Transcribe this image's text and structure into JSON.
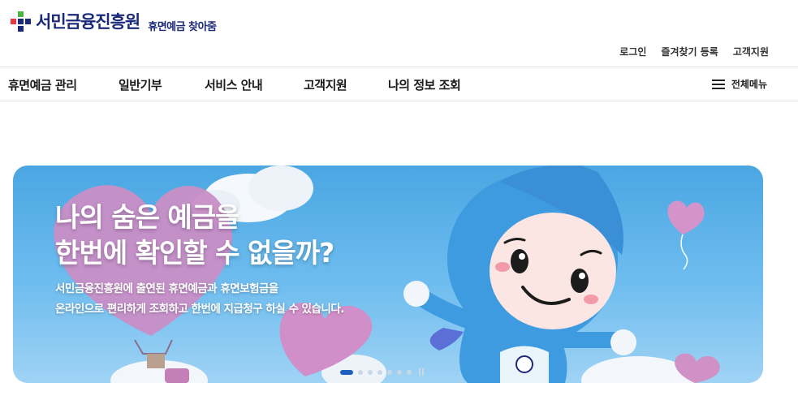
{
  "header": {
    "logo_text": "서민금융진흥원",
    "logo_sub": "휴면예금 찾아줌",
    "util_links": [
      "로그인",
      "즐겨찾기 등록",
      "고객지원"
    ]
  },
  "gnb": {
    "items": [
      "휴면예금 관리",
      "일반기부",
      "서비스 안내",
      "고객지원",
      "나의 정보 조회"
    ],
    "all_menu_label": "전체메뉴"
  },
  "banner": {
    "headline_line1": "나의 숨은 예금을",
    "headline_line2": "한번에 확인할 수 없을까?",
    "desc_line1": "서민금융진흥원에 출연된 휴면예금과 휴면보험금을",
    "desc_line2": "온라인으로 편리하게 조회하고 한번에 지급청구 하실 수 있습니다.",
    "slide_count": 7,
    "active_slide": 1
  },
  "colors": {
    "brand_navy": "#1b2a78",
    "banner_blue": "#4aa6e2",
    "active_dot": "#1d5fbf"
  }
}
